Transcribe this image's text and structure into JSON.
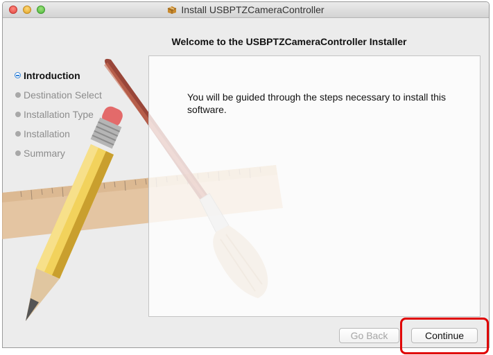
{
  "window": {
    "title": "Install USBPTZCameraController",
    "title_icon": "package-icon"
  },
  "header": {
    "title": "Welcome to the USBPTZCameraController Installer"
  },
  "sidebar": {
    "steps": [
      {
        "label": "Introduction",
        "state": "active"
      },
      {
        "label": "Destination Select",
        "state": "pending"
      },
      {
        "label": "Installation Type",
        "state": "pending"
      },
      {
        "label": "Installation",
        "state": "pending"
      },
      {
        "label": "Summary",
        "state": "pending"
      }
    ]
  },
  "main": {
    "body_text": "You will be guided through the steps necessary to install this software."
  },
  "buttons": {
    "go_back": "Go Back",
    "continue": "Continue"
  },
  "colors": {
    "active_step": "#2e7fd6",
    "highlight": "#e00000"
  }
}
